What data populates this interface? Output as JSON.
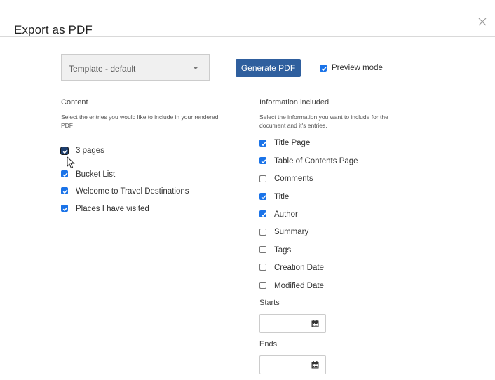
{
  "dialog": {
    "title": "Export as PDF",
    "close_icon": "close-icon"
  },
  "toolbar": {
    "template_value": "Template - default",
    "generate_label": "Generate PDF",
    "preview_label": "Preview mode",
    "preview_checked": true
  },
  "content": {
    "title": "Content",
    "description": "Select the entries you would like to include in your rendered PDF",
    "items": [
      {
        "label": "3 pages",
        "checked": true
      },
      {
        "label": "Bucket List",
        "checked": true
      },
      {
        "label": "Welcome to Travel Destinations",
        "checked": true
      },
      {
        "label": "Places I have visited",
        "checked": true
      }
    ]
  },
  "info": {
    "title": "Information included",
    "description": "Select the information you want to include for the document and it's entries.",
    "items": [
      {
        "label": "Title Page",
        "checked": true
      },
      {
        "label": "Table of Contents Page",
        "checked": true
      },
      {
        "label": "Comments",
        "checked": false
      },
      {
        "label": "Title",
        "checked": true
      },
      {
        "label": "Author",
        "checked": true
      },
      {
        "label": "Summary",
        "checked": false
      },
      {
        "label": "Tags",
        "checked": false
      },
      {
        "label": "Creation Date",
        "checked": false
      },
      {
        "label": "Modified Date",
        "checked": false
      }
    ]
  },
  "dates": {
    "starts_label": "Starts",
    "starts_value": "",
    "ends_label": "Ends",
    "ends_value": "",
    "calendar_icon": "calendar-icon"
  },
  "colors": {
    "primary_button": "#2f5f9e",
    "checkbox_checked": "#1a73e8",
    "select_bg": "#f0f0f0"
  }
}
